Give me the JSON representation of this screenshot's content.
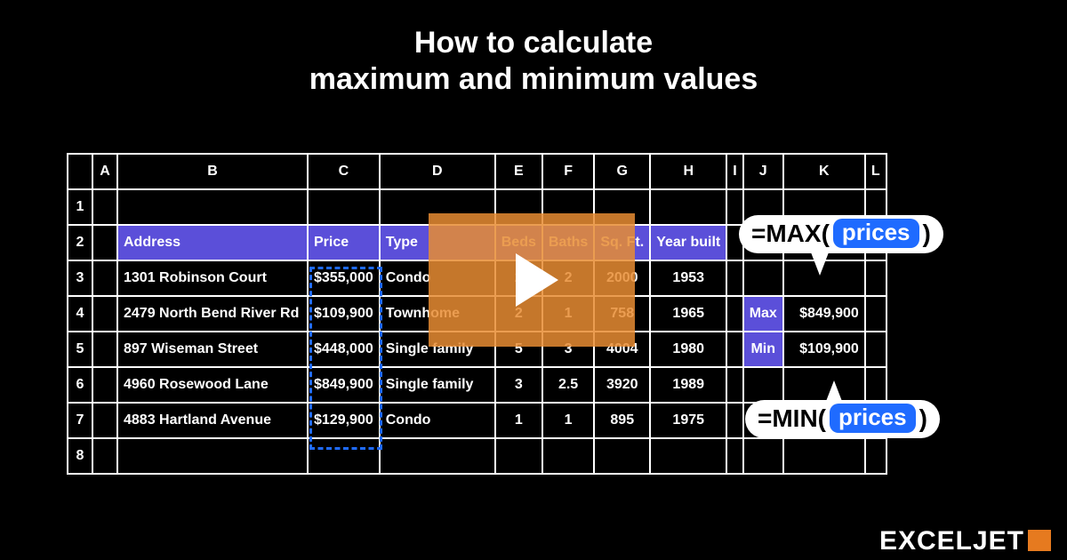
{
  "title_line1": "How to calculate",
  "title_line2": "maximum and minimum values",
  "cols": [
    "A",
    "B",
    "C",
    "D",
    "E",
    "F",
    "G",
    "H",
    "I",
    "J",
    "K",
    "L"
  ],
  "rows": [
    "1",
    "2",
    "3",
    "4",
    "5",
    "6",
    "7",
    "8"
  ],
  "headers": {
    "address": "Address",
    "price": "Price",
    "type": "Type",
    "beds": "Beds",
    "baths": "Baths",
    "sqft": "Sq. Ft.",
    "year": "Year built"
  },
  "records": [
    {
      "address": "1301 Robinson Court",
      "price": "$355,000",
      "type": "Condo",
      "beds": "2",
      "baths": "2",
      "sqft": "2000",
      "year": "1953"
    },
    {
      "address": "2479 North Bend River Rd",
      "price": "$109,900",
      "type": "Townhome",
      "beds": "2",
      "baths": "1",
      "sqft": "758",
      "year": "1965"
    },
    {
      "address": "897 Wiseman Street",
      "price": "$448,000",
      "type": "Single family",
      "beds": "5",
      "baths": "3",
      "sqft": "4004",
      "year": "1980"
    },
    {
      "address": "4960 Rosewood Lane",
      "price": "$849,900",
      "type": "Single family",
      "beds": "3",
      "baths": "2.5",
      "sqft": "3920",
      "year": "1989"
    },
    {
      "address": "4883 Hartland Avenue",
      "price": "$129,900",
      "type": "Condo",
      "beds": "1",
      "baths": "1",
      "sqft": "895",
      "year": "1975"
    }
  ],
  "summary": {
    "max_label": "Max",
    "min_label": "Min",
    "max_value": "$849,900",
    "min_value": "$109,900"
  },
  "formulas": {
    "max_prefix": "=MAX(",
    "max_arg": "prices",
    "max_suffix": ")",
    "min_prefix": "=MIN(",
    "min_arg": "prices",
    "min_suffix": ")"
  },
  "brand": "EXCELJET"
}
